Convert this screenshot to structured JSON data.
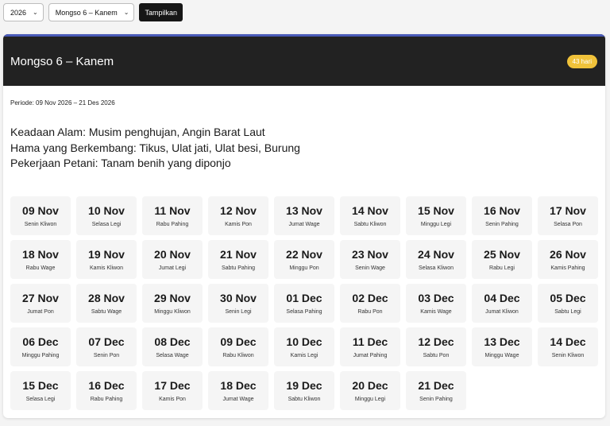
{
  "controls": {
    "year": "2026",
    "mongso": "Mongso 6 – Kanem",
    "submit_label": "Tampilkan"
  },
  "colors": {
    "header_bg": "#222222",
    "header_accent": "#4a5bb8",
    "badge": "#f0c23a"
  },
  "card": {
    "title": "Mongso 6 – Kanem",
    "badge": "43 hari",
    "periode": "Periode: 09 Nov 2026 – 21 Des 2026",
    "info": [
      "Keadaan Alam: Musim penghujan, Angin Barat Laut",
      "Hama yang Berkembang: Tikus, Ulat jati, Ulat besi, Burung",
      "Pekerjaan Petani: Tanam benih yang diponjo"
    ]
  },
  "days": [
    {
      "date": "09 Nov",
      "pasaran": "Senin Kliwon"
    },
    {
      "date": "10 Nov",
      "pasaran": "Selasa Legi"
    },
    {
      "date": "11 Nov",
      "pasaran": "Rabu Pahing"
    },
    {
      "date": "12 Nov",
      "pasaran": "Kamis Pon"
    },
    {
      "date": "13 Nov",
      "pasaran": "Jumat Wage"
    },
    {
      "date": "14 Nov",
      "pasaran": "Sabtu Kliwon"
    },
    {
      "date": "15 Nov",
      "pasaran": "Minggu Legi"
    },
    {
      "date": "16 Nov",
      "pasaran": "Senin Pahing"
    },
    {
      "date": "17 Nov",
      "pasaran": "Selasa Pon"
    },
    {
      "date": "18 Nov",
      "pasaran": "Rabu Wage"
    },
    {
      "date": "19 Nov",
      "pasaran": "Kamis Kliwon"
    },
    {
      "date": "20 Nov",
      "pasaran": "Jumat Legi"
    },
    {
      "date": "21 Nov",
      "pasaran": "Sabtu Pahing"
    },
    {
      "date": "22 Nov",
      "pasaran": "Minggu Pon"
    },
    {
      "date": "23 Nov",
      "pasaran": "Senin Wage"
    },
    {
      "date": "24 Nov",
      "pasaran": "Selasa Kliwon"
    },
    {
      "date": "25 Nov",
      "pasaran": "Rabu Legi"
    },
    {
      "date": "26 Nov",
      "pasaran": "Kamis Pahing"
    },
    {
      "date": "27 Nov",
      "pasaran": "Jumat Pon"
    },
    {
      "date": "28 Nov",
      "pasaran": "Sabtu Wage"
    },
    {
      "date": "29 Nov",
      "pasaran": "Minggu Kliwon"
    },
    {
      "date": "30 Nov",
      "pasaran": "Senin Legi"
    },
    {
      "date": "01 Dec",
      "pasaran": "Selasa Pahing"
    },
    {
      "date": "02 Dec",
      "pasaran": "Rabu Pon"
    },
    {
      "date": "03 Dec",
      "pasaran": "Kamis Wage"
    },
    {
      "date": "04 Dec",
      "pasaran": "Jumat Kliwon"
    },
    {
      "date": "05 Dec",
      "pasaran": "Sabtu Legi"
    },
    {
      "date": "06 Dec",
      "pasaran": "Minggu Pahing"
    },
    {
      "date": "07 Dec",
      "pasaran": "Senin Pon"
    },
    {
      "date": "08 Dec",
      "pasaran": "Selasa Wage"
    },
    {
      "date": "09 Dec",
      "pasaran": "Rabu Kliwon"
    },
    {
      "date": "10 Dec",
      "pasaran": "Kamis Legi"
    },
    {
      "date": "11 Dec",
      "pasaran": "Jumat Pahing"
    },
    {
      "date": "12 Dec",
      "pasaran": "Sabtu Pon"
    },
    {
      "date": "13 Dec",
      "pasaran": "Minggu Wage"
    },
    {
      "date": "14 Dec",
      "pasaran": "Senin Kliwon"
    },
    {
      "date": "15 Dec",
      "pasaran": "Selasa Legi"
    },
    {
      "date": "16 Dec",
      "pasaran": "Rabu Pahing"
    },
    {
      "date": "17 Dec",
      "pasaran": "Kamis Pon"
    },
    {
      "date": "18 Dec",
      "pasaran": "Jumat Wage"
    },
    {
      "date": "19 Dec",
      "pasaran": "Sabtu Kliwon"
    },
    {
      "date": "20 Dec",
      "pasaran": "Minggu Legi"
    },
    {
      "date": "21 Dec",
      "pasaran": "Senin Pahing"
    }
  ]
}
